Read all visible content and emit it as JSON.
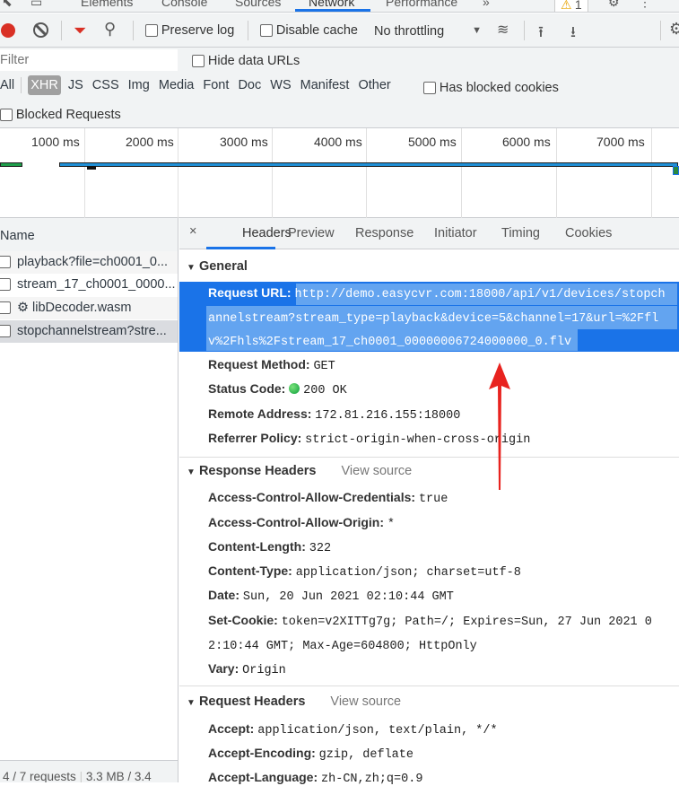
{
  "top_tabs": [
    "Elements",
    "Console",
    "Sources",
    "Network",
    "Performance"
  ],
  "active_top_tab": "Network",
  "warning_count": "1",
  "toolbar": {
    "preserve_log": "Preserve log",
    "disable_cache": "Disable cache",
    "throttling": "No throttling"
  },
  "filter": {
    "placeholder": "Filter",
    "hide_data_urls": "Hide data URLs",
    "types": [
      "All",
      "XHR",
      "JS",
      "CSS",
      "Img",
      "Media",
      "Font",
      "Doc",
      "WS",
      "Manifest",
      "Other"
    ],
    "active_type": "XHR",
    "has_blocked_cookies": "Has blocked cookies",
    "blocked_requests": "Blocked Requests"
  },
  "timeline": {
    "ticks": [
      "1000 ms",
      "2000 ms",
      "3000 ms",
      "4000 ms",
      "5000 ms",
      "6000 ms",
      "7000 ms"
    ]
  },
  "list": {
    "header": "Name",
    "items": [
      "playback?file=ch0001_0...",
      "stream_17_ch0001_0000...",
      "libDecoder.wasm",
      "stopchannelstream?stre..."
    ],
    "selected": 3,
    "status": "4 / 7 requests",
    "size": "3.3 MB / 3.4"
  },
  "detail": {
    "tabs": [
      "Headers",
      "Preview",
      "Response",
      "Initiator",
      "Timing",
      "Cookies"
    ],
    "active_tab": "Headers",
    "general": {
      "title": "General",
      "rows": [
        {
          "k": "Request URL:",
          "v": "http://demo.easycvr.com:18000/api/v1/devices/stopch",
          "v2": "annelstream?stream_type=playback&device=5&channel=17&url=%2Ffl",
          "v3": "v%2Fhls%2Fstream_17_ch0001_00000006724000000_0.flv"
        },
        {
          "k": "Request Method:",
          "v": "GET"
        },
        {
          "k": "Status Code:",
          "v": "200 OK",
          "status_color": "#0a9e3c"
        },
        {
          "k": "Remote Address:",
          "v": "172.81.216.155:18000"
        },
        {
          "k": "Referrer Policy:",
          "v": "strict-origin-when-cross-origin"
        }
      ]
    },
    "response_headers": {
      "title": "Response Headers",
      "view_source": "View source",
      "rows": [
        {
          "k": "Access-Control-Allow-Credentials:",
          "v": "true"
        },
        {
          "k": "Access-Control-Allow-Origin:",
          "v": "*"
        },
        {
          "k": "Content-Length:",
          "v": "322"
        },
        {
          "k": "Content-Type:",
          "v": "application/json; charset=utf-8"
        },
        {
          "k": "Date:",
          "v": "Sun, 20 Jun 2021 02:10:44 GMT"
        },
        {
          "k": "Set-Cookie:",
          "v": "token=v2XITTg7g; Path=/; Expires=Sun, 27 Jun 2021 0",
          "v2": "2:10:44 GMT; Max-Age=604800; HttpOnly"
        },
        {
          "k": "Vary:",
          "v": "Origin"
        }
      ]
    },
    "request_headers": {
      "title": "Request Headers",
      "view_source": "View source",
      "rows": [
        {
          "k": "Accept:",
          "v": "application/json, text/plain, */*"
        },
        {
          "k": "Accept-Encoding:",
          "v": "gzip, deflate"
        },
        {
          "k": "Accept-Language:",
          "v": "zh-CN,zh;q=0.9"
        }
      ]
    }
  },
  "colors": {
    "accent": "#1a73e8",
    "selection": "#1a73e8",
    "record": "#d93025",
    "annotation_arrow": "#e8231f"
  }
}
